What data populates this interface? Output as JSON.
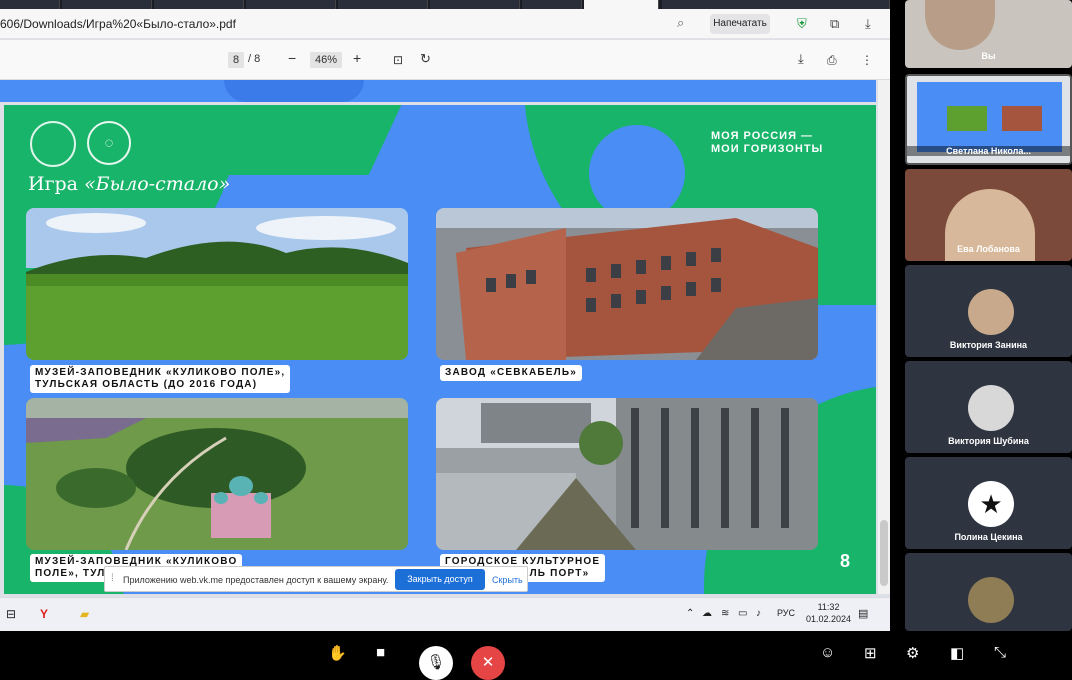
{
  "browser": {
    "url": "606/Downloads/Игра%20«Было-стало».pdf",
    "print_label": "Напечатать"
  },
  "pdf_toolbar": {
    "page_current": "8",
    "page_sep_total": "/ 8",
    "zoom": "46%"
  },
  "slide": {
    "title_plain": "Игра ",
    "title_italic": "«Было-стало»",
    "slogan_line1": "МОЯ РОССИЯ —",
    "slogan_line2": "МОИ ГОРИЗОНТЫ",
    "captions": [
      {
        "line1": "МУЗЕЙ-ЗАПОВЕДНИК «КУЛИКОВО ПОЛЕ»,",
        "line2": "ТУЛЬСКАЯ ОБЛАСТЬ (ДО 2016 ГОДА)"
      },
      {
        "line1": "ЗАВОД «СЕВКАБЕЛЬ»"
      },
      {
        "line1": "МУЗЕЙ-ЗАПОВЕДНИК «КУЛИКОВО",
        "line2": "ПОЛЕ», ТУЛ"
      },
      {
        "line1": "ГОРОДСКОЕ КУЛЬТУРНОЕ",
        "line2": "ВО «СЕВКАБЕЛЬ ПОРТ»"
      }
    ],
    "page_number": "8"
  },
  "screen_share_notice": {
    "text": "Приложению web.vk.me предоставлен доступ к вашему экрану.",
    "allow_button": "Закрыть доступ",
    "hide_link": "Скрыть"
  },
  "taskbar": {
    "lang": "РУС",
    "time": "11:32",
    "date": "01.02.2024"
  },
  "participants": [
    {
      "name": "Вы"
    },
    {
      "name": "Светлана Никола..."
    },
    {
      "name": "Ева Лобанова"
    },
    {
      "name": "Виктория Занина"
    },
    {
      "name": "Виктория Шубина"
    },
    {
      "name": "Полина Цекина"
    }
  ],
  "icons": [
    "hand-icon",
    "camera-icon",
    "mic-off-icon",
    "hangup-icon",
    "participants-icon",
    "grid-icon",
    "settings-icon",
    "window-icon",
    "fullscreen-icon"
  ],
  "colors": {
    "slide_blue": "#4a8df5",
    "slide_green": "#18b46a",
    "hangup": "#e64545",
    "vk_blue": "#1d6fd8"
  }
}
